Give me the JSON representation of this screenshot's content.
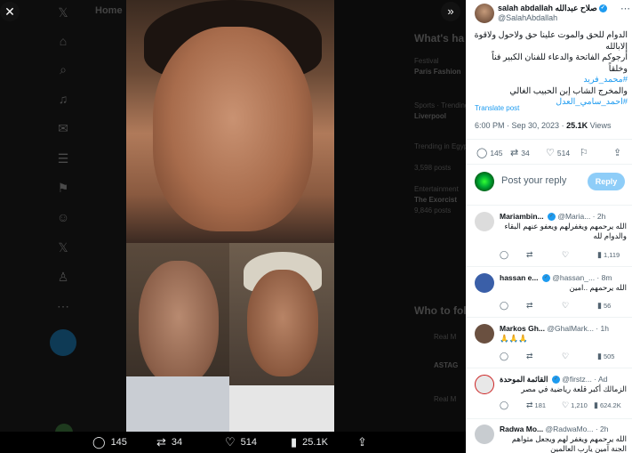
{
  "background": {
    "sidebar_icons": [
      "x-logo-icon",
      "home-icon",
      "explore-icon",
      "notifications-icon",
      "messages-icon",
      "lists-icon",
      "bookmarks-icon",
      "communities-icon",
      "premium-icon",
      "profile-icon",
      "more-icon"
    ],
    "header": "Home",
    "right_heading": "What's ha",
    "trend_items": [
      "Festival",
      "Paris Fashion",
      "Sports · Trending",
      "Liverpool",
      "Trending in Egypt",
      "3,598 posts",
      "Entertainment",
      "The Exorcist",
      "9,846 posts"
    ],
    "who_to_follow": "Who to fol",
    "follow_names": [
      "Real M",
      "ASTAG",
      "Real M"
    ]
  },
  "media": {
    "close_icon": "close-icon",
    "expand_icon": "expand-icon"
  },
  "action_bar": {
    "replies": "145",
    "reposts": "34",
    "likes": "514",
    "views": "25.1K"
  },
  "post": {
    "author_name": "salah abdallah صلاح عبدالله",
    "author_handle": "@SalahAbdallah",
    "body_lines": [
      "الدوام للحق والموت علينا حق ولاحول ولاقوة إلابالله",
      "أرجوكم الفاتحة والدعاء للفنان الكبير فناً وخلقاً",
      "#محمد_فريد",
      "والمخرج الشاب إبن الحبيب الغالي",
      "#احمد_سامي_العدل"
    ],
    "translate": "Translate post",
    "time": "6:00 PM · Sep 30, 2023 · ",
    "views": "25.1K",
    "views_label": " Views",
    "stats": {
      "replies": "145",
      "reposts": "34",
      "likes": "514"
    },
    "reply_placeholder": "Post your reply",
    "reply_button": "Reply"
  },
  "replies": [
    {
      "name": "Mariambin...",
      "handle": "@Maria... · 2h",
      "text": "الله يرحمهم ويغفرلهم ويعفو عنهم البقاء والدوام لله",
      "views": "1,119",
      "avatar_color": "#dcdcdc"
    },
    {
      "name": "hassan e...",
      "handle": "@hassan_... · 8m",
      "text": "الله يرحمهم ..امين",
      "views": "56",
      "avatar_color": "#3a5fa8"
    },
    {
      "name": "Markos Gh...",
      "handle": "@GhalMark... · 1h",
      "text": "🙏🙏🙏",
      "views": "505",
      "avatar_color": "#6a5040"
    },
    {
      "name": "القائمة الموحدة",
      "handle": "@firstz... · Ad",
      "text": "الزمالك أكبر قلعة رياضية في مصر",
      "reposts": "181",
      "likes": "1,210",
      "views": "624.2K",
      "avatar_color": "#e8e8e8"
    },
    {
      "name": "Radwa Mo...",
      "handle": "@RadwaMo... · 2h",
      "text": "الله يرحمهم ويغفر لهم ويجعل مثواهم الجنة آمين يارب العالمين",
      "avatar_color": "#c8ccd0"
    }
  ]
}
